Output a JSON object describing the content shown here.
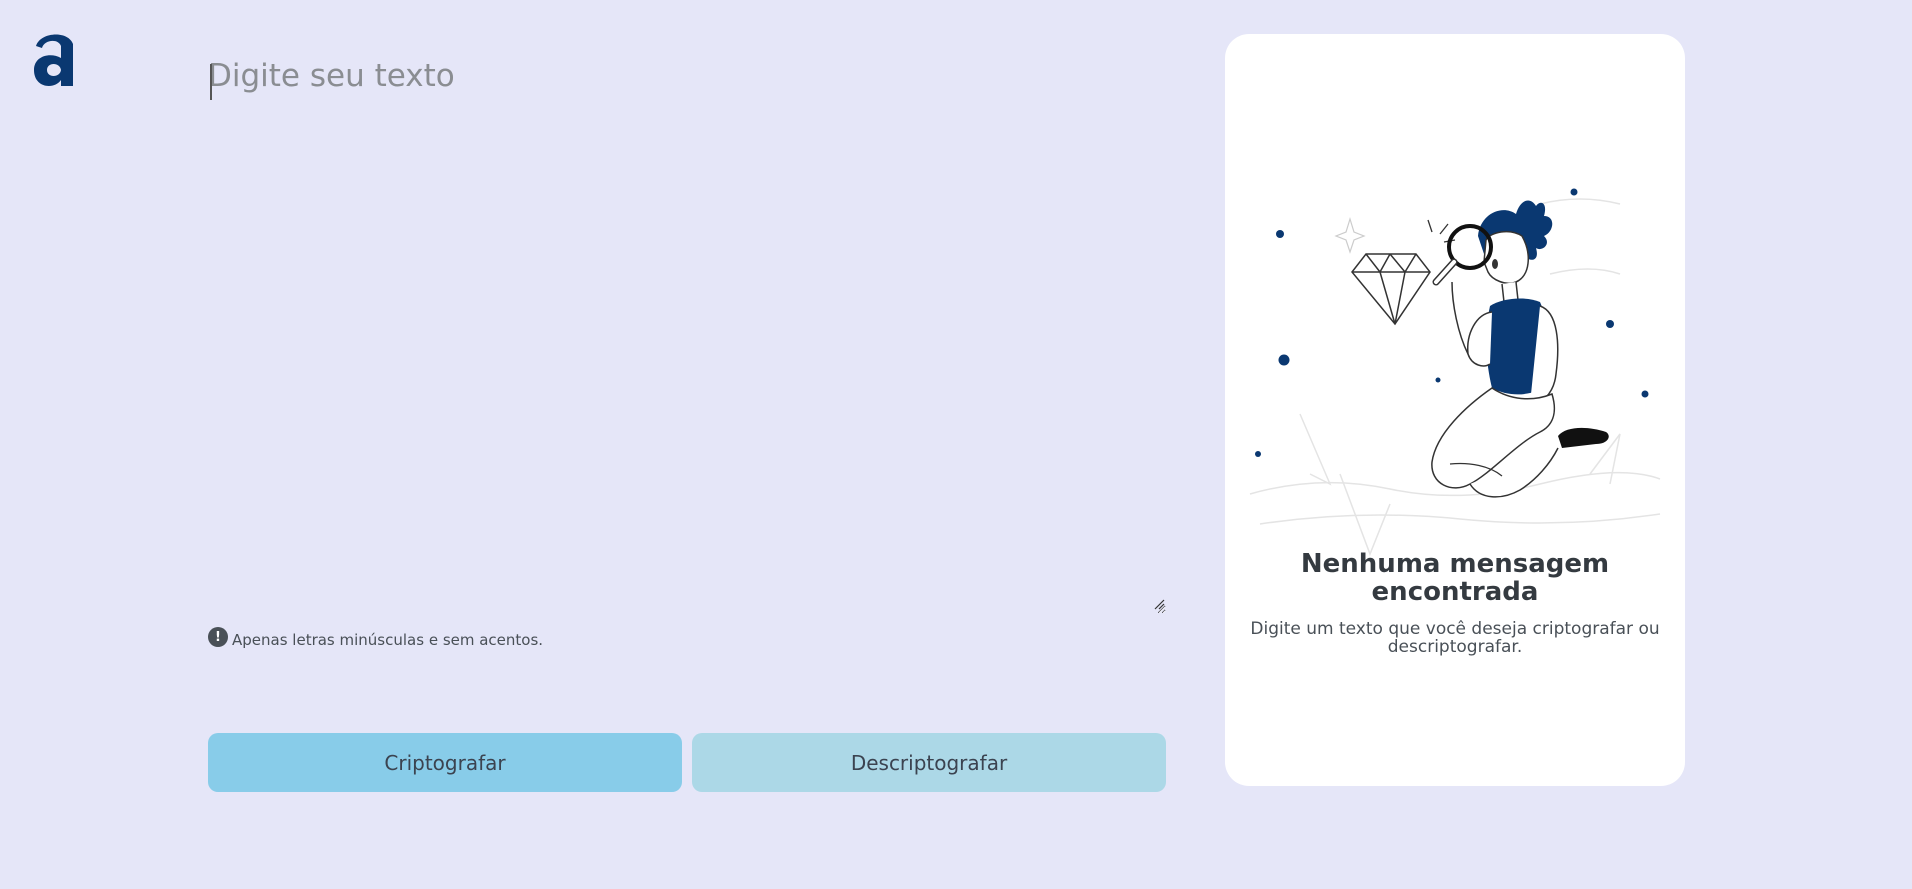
{
  "logo": {
    "letter": "a",
    "color": "#0a3871"
  },
  "input": {
    "placeholder": "Digite seu texto",
    "value": ""
  },
  "hint": {
    "icon": "exclamation-circle-icon",
    "text": "Apenas letras minúsculas e sem acentos."
  },
  "buttons": {
    "encrypt_label": "Criptografar",
    "decrypt_label": "Descriptografar"
  },
  "output_panel": {
    "title": "Nenhuma mensagem encontrada",
    "description": "Digite um texto que você deseja criptografar ou descriptografar.",
    "illustration": "person-with-magnifying-glass-and-diamond"
  },
  "colors": {
    "background": "#e5e6f8",
    "brand": "#0a3871",
    "encrypt_button": "#88cce9",
    "decrypt_button": "#acd8e7",
    "panel": "#ffffff"
  }
}
